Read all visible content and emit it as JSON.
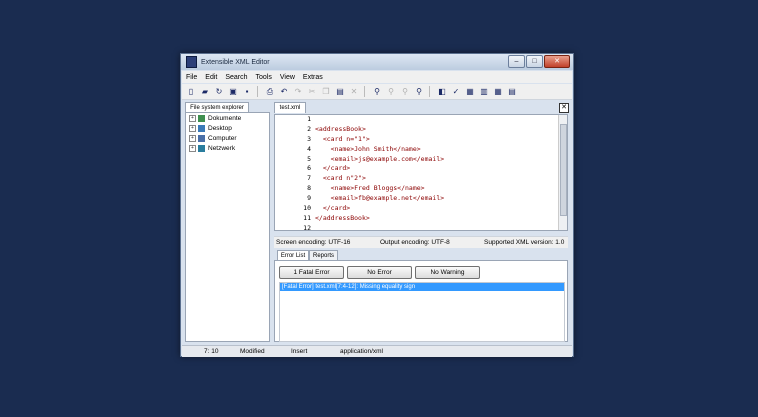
{
  "window": {
    "title": "Extensible XML Editor",
    "controls": [
      "–",
      "□",
      "✕"
    ]
  },
  "menu": [
    "File",
    "Edit",
    "Search",
    "Tools",
    "View",
    "Extras"
  ],
  "toolbar": {
    "groups": [
      [
        "new-file-icon",
        "open-folder-icon",
        "refresh-icon",
        "save-icon",
        "save-small-icon"
      ],
      [
        "print-icon",
        "undo-icon",
        "redo-icon",
        "cut-icon",
        "copy-icon",
        "paste-icon",
        "delete-icon"
      ],
      [
        "find-icon",
        "find-next-icon",
        "find-prev-icon",
        "replace-icon"
      ],
      [
        "validate-icon",
        "check-icon",
        "xsd-icon",
        "transform-icon",
        "xslt-icon",
        "xpath-icon"
      ]
    ]
  },
  "explorer": {
    "tab_label": "File system explorer",
    "items": [
      {
        "label": "Dokumente",
        "color": "#3f8f4f"
      },
      {
        "label": "Desktop",
        "color": "#3b7ab8"
      },
      {
        "label": "Computer",
        "color": "#4a6fa8"
      },
      {
        "label": "Netzwerk",
        "color": "#2a7d9e"
      }
    ]
  },
  "editor": {
    "tab_label": "test.xml",
    "close_label": "✕",
    "lines": [
      {
        "n": "1",
        "code": ""
      },
      {
        "n": "2",
        "code": "<addressBook>"
      },
      {
        "n": "3",
        "code": "  <card n=\"1\">"
      },
      {
        "n": "4",
        "code": "    <name>John Smith</name>"
      },
      {
        "n": "5",
        "code": "    <email>js@example.com</email>"
      },
      {
        "n": "6",
        "code": "  </card>"
      },
      {
        "n": "7",
        "code": "  <card n\"2\">"
      },
      {
        "n": "8",
        "code": "    <name>Fred Bloggs</name>"
      },
      {
        "n": "9",
        "code": "    <email>fb@example.net</email>"
      },
      {
        "n": "10",
        "code": "  </card>"
      },
      {
        "n": "11",
        "code": "</addressBook>"
      },
      {
        "n": "12",
        "code": ""
      }
    ]
  },
  "encoding": {
    "screen": "Screen encoding: UTF-16",
    "output": "Output encoding: UTF-8",
    "xml_version": "Supported XML version: 1.0"
  },
  "bottom_tabs": [
    "Error List",
    "Reports"
  ],
  "errors": {
    "buttons": [
      "1 Fatal Error",
      "No Error",
      "No Warning"
    ],
    "rows": [
      "[Fatal Error] test.xml[7:4-12]: Missing equality sign"
    ]
  },
  "status": {
    "position": "7: 10",
    "state": "Modified",
    "mode": "Insert",
    "mime": "application/xml"
  },
  "colors": {
    "desktop": "#1a2c50",
    "tag_color": "#8b0000",
    "selection": "#3399ff"
  }
}
